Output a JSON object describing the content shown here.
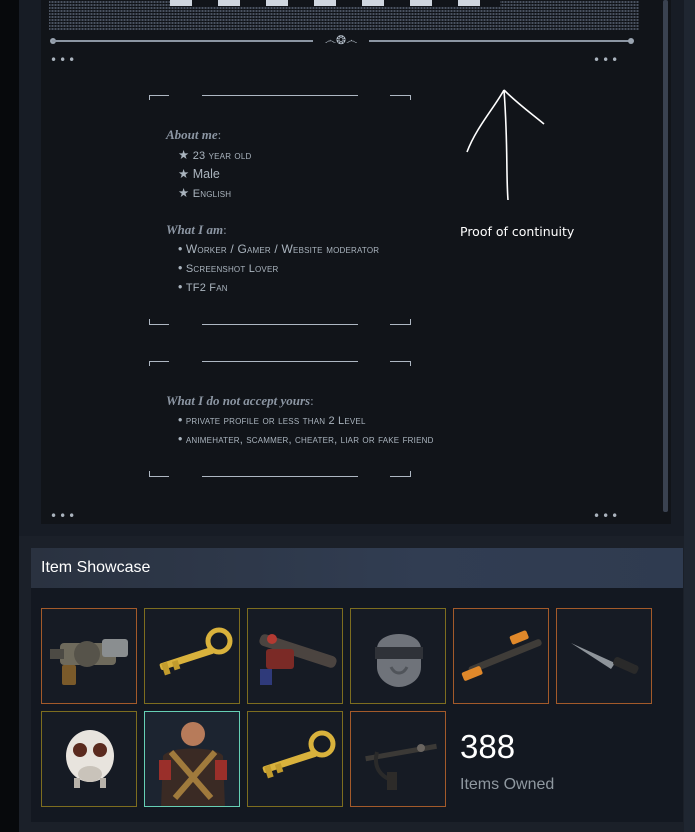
{
  "summary": {
    "divider_ornament": "෴❂෴",
    "corner_dots": "•••",
    "about_heading": "About me",
    "about_colon": ":",
    "about_items": [
      {
        "bullet": "★",
        "text": "23 year old"
      },
      {
        "bullet": "★",
        "text": "Male"
      },
      {
        "bullet": "★",
        "text": "English"
      }
    ],
    "whatiam_heading": "What I am",
    "whatiam_colon": ":",
    "whatiam_items": [
      {
        "bullet": "•",
        "text": "Worker / Gamer / Website moderator"
      },
      {
        "bullet": "•",
        "text": "Screenshot Lover"
      },
      {
        "bullet": "•",
        "text": "TF2 Fan"
      }
    ],
    "reject_heading": "What I do not accept yours",
    "reject_colon": ":",
    "reject_items": [
      {
        "bullet": "•",
        "text": "private profile or less than 2 Level"
      },
      {
        "bullet": "•",
        "text": "animehater, scammer, cheater, liar or fake friend"
      }
    ],
    "annotation": "Proof of continuity"
  },
  "showcase": {
    "title": "Item Showcase",
    "count": "388",
    "count_label": "Items Owned",
    "items": [
      {
        "icon": "grenade-launcher-icon",
        "quality": "strange",
        "border": "#c55c2c"
      },
      {
        "icon": "crate-key-icon",
        "quality": "unique",
        "border": "#7d6d1f"
      },
      {
        "icon": "rocket-launcher-icon",
        "quality": "unique",
        "border": "#7d6d1f"
      },
      {
        "icon": "helmet-icon",
        "quality": "unique",
        "border": "#7d6d1f"
      },
      {
        "icon": "shotgun-icon",
        "quality": "strange",
        "border": "#c55c2c"
      },
      {
        "icon": "knife-icon",
        "quality": "strange",
        "border": "#c55c2c"
      },
      {
        "icon": "gas-mask-icon",
        "quality": "unique",
        "border": "#7d6d1f"
      },
      {
        "icon": "heavy-character-icon",
        "quality": "vintage",
        "border": "#66d0b5"
      },
      {
        "icon": "crate-key-icon",
        "quality": "unique",
        "border": "#7d6d1f"
      },
      {
        "icon": "crossbow-icon",
        "quality": "strange",
        "border": "#c55c2c"
      }
    ]
  },
  "colors": {
    "background": "#1b2029",
    "panel": "#111419",
    "text_muted": "#8f98a0",
    "strange_border": "#c55c2c",
    "unique_border": "#7d6d1f",
    "vintage_border": "#66d0b5"
  }
}
